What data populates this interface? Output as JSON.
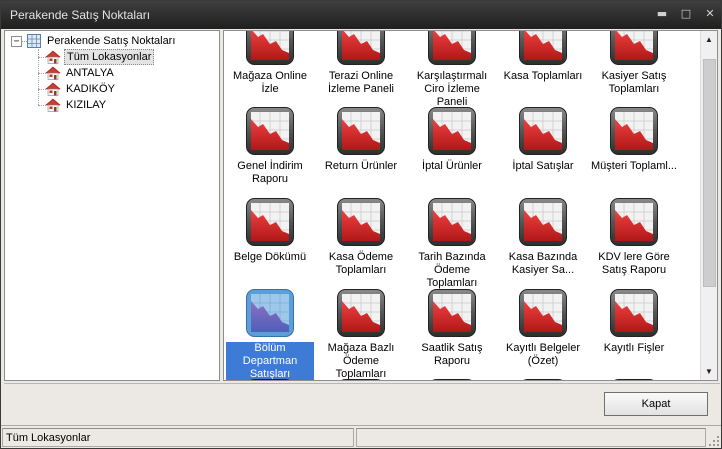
{
  "window": {
    "title": "Perakende Satış Noktaları",
    "controls": [
      "minimize-icon",
      "maximize-icon",
      "close-icon"
    ]
  },
  "tree": {
    "root": {
      "label": "Perakende Satış Noktaları",
      "expander": "−",
      "icon": "grid-icon"
    },
    "children": [
      {
        "label": "Tüm Lokasyonlar",
        "selected": true,
        "icon": "house-icon"
      },
      {
        "label": "ANTALYA",
        "icon": "house-icon"
      },
      {
        "label": "KADIKÖY",
        "icon": "house-icon"
      },
      {
        "label": "KIZILAY",
        "icon": "house-icon"
      }
    ]
  },
  "reports": {
    "row1": [
      "Mağaza Online İzle",
      "Terazi Online İzleme Paneli",
      "Karşılaştırmalı Ciro İzleme Paneli",
      "Kasa Toplamları",
      "Kasiyer Satış Toplamları"
    ],
    "row2": [
      "Genel İndirim Raporu",
      "Return Ürünler",
      "İptal Ürünler",
      "İptal Satışlar",
      "Müşteri Toplaml..."
    ],
    "row3": [
      "Belge Dökümü",
      "Kasa Ödeme Toplamları",
      "Tarih Bazında Ödeme Toplamları",
      "Kasa Bazında Kasiyer Sa...",
      "KDV lere Göre Satış Raporu"
    ],
    "row4": [
      "Bölüm Departman Satışları",
      "Mağaza Bazlı Ödeme Toplamları",
      "Saatlik Satış Raporu",
      "Kayıtlı Belgeler (Özet)",
      "Kayıtlı Fişler"
    ],
    "selected": "Bölüm Departman Satışları"
  },
  "buttons": {
    "close_label": "Kapat"
  },
  "status": {
    "location": "Tüm Lokasyonlar",
    "cell2": "",
    "cell3": ""
  },
  "colors": {
    "titlebar": "#2b2b2b",
    "selection": "#3d7bd6",
    "icon_red": "#d42a2a"
  }
}
